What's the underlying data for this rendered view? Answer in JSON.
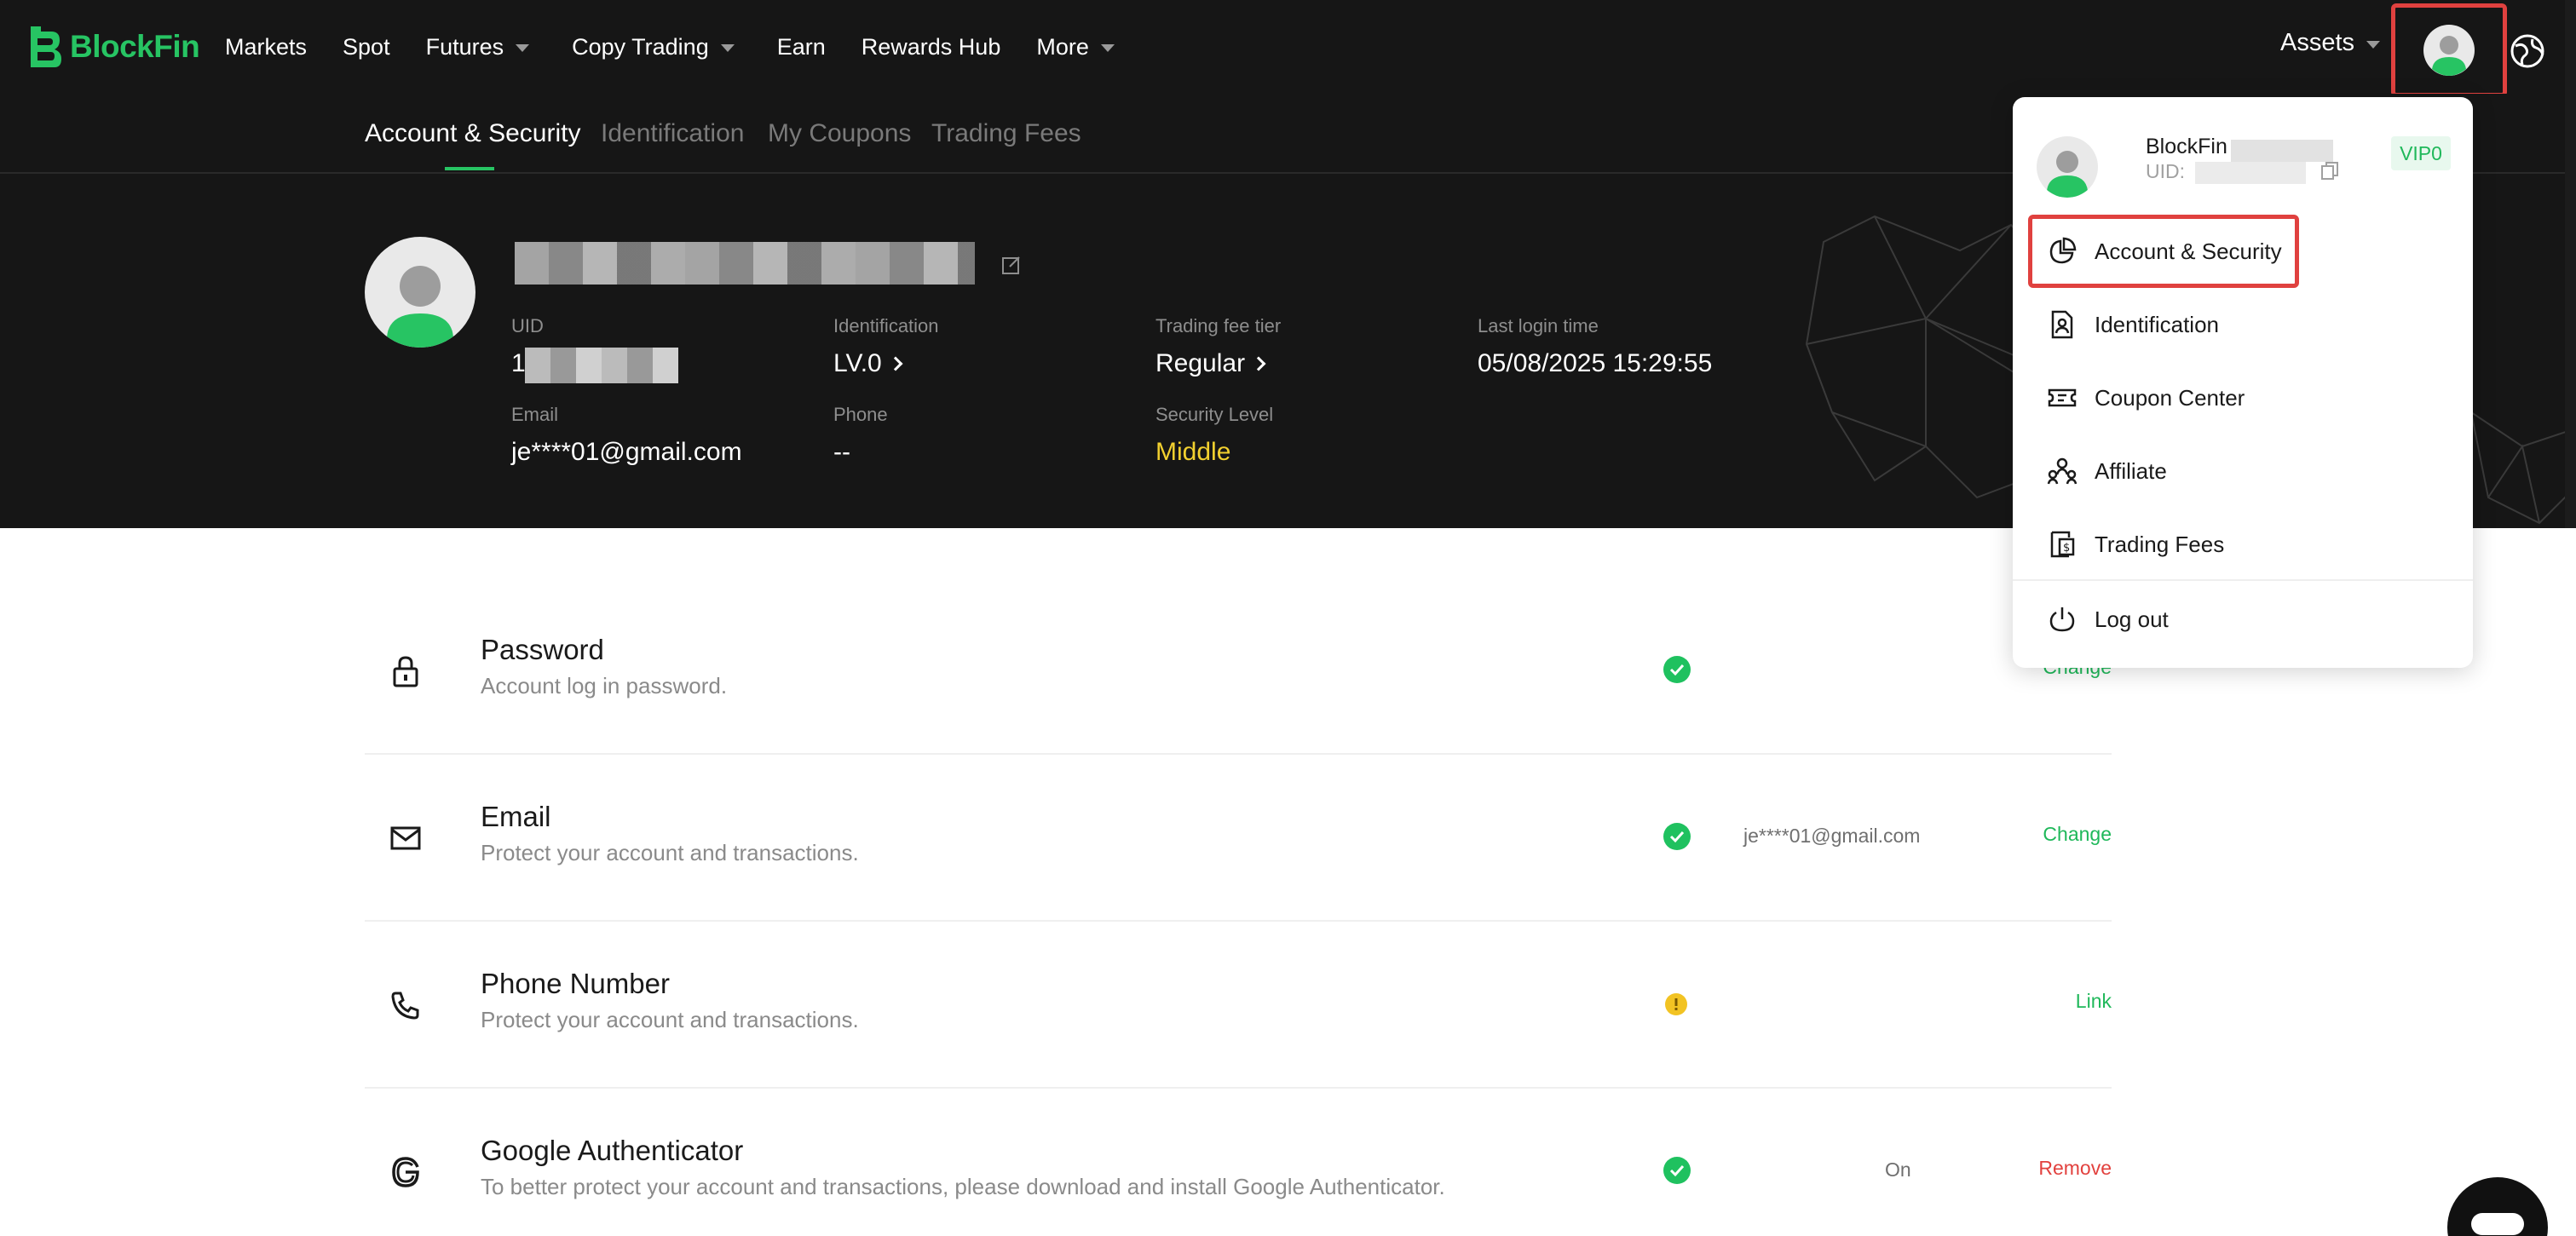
{
  "brand": {
    "name": "BlockFin",
    "accent": "#27c463"
  },
  "nav": {
    "items": [
      {
        "label": "Markets",
        "dropdown": false
      },
      {
        "label": "Spot",
        "dropdown": false
      },
      {
        "label": "Futures",
        "dropdown": true
      },
      {
        "label": "Copy Trading",
        "dropdown": true
      },
      {
        "label": "Earn",
        "dropdown": false
      },
      {
        "label": "Rewards Hub",
        "dropdown": false
      },
      {
        "label": "More",
        "dropdown": true
      }
    ],
    "assets_label": "Assets"
  },
  "tabs": [
    {
      "label": "Account & Security",
      "active": true
    },
    {
      "label": "Identification",
      "active": false
    },
    {
      "label": "My Coupons",
      "active": false
    },
    {
      "label": "Trading Fees",
      "active": false
    }
  ],
  "profile": {
    "uid_label": "UID",
    "uid_value": "1",
    "identification_label": "Identification",
    "identification_value": "LV.0",
    "fee_tier_label": "Trading fee tier",
    "fee_tier_value": "Regular",
    "last_login_label": "Last login time",
    "last_login_value": "05/08/2025 15:29:55",
    "email_label": "Email",
    "email_value": "je****01@gmail.com",
    "phone_label": "Phone",
    "phone_value": "--",
    "security_label": "Security Level",
    "security_value": "Middle"
  },
  "security_rows": [
    {
      "title": "Password",
      "desc": "Account log in password.",
      "status": "ok",
      "value": "",
      "action": "Change",
      "action_color": "green",
      "icon": "lock-icon"
    },
    {
      "title": "Email",
      "desc": "Protect your account and transactions.",
      "status": "ok",
      "value": "je****01@gmail.com",
      "action": "Change",
      "action_color": "green",
      "icon": "mail-icon"
    },
    {
      "title": "Phone Number",
      "desc": "Protect your account and transactions.",
      "status": "warn",
      "value": "",
      "action": "Link",
      "action_color": "green",
      "icon": "phone-icon"
    },
    {
      "title": "Google Authenticator",
      "desc": "To better protect your account and transactions, please download and install Google Authenticator.",
      "status": "ok",
      "value": "On",
      "action": "Remove",
      "action_color": "red",
      "icon": "google-icon"
    }
  ],
  "dropdown": {
    "name": "BlockFin",
    "uid_label": "UID:",
    "vip": "VIP0",
    "items": [
      {
        "label": "Account & Security",
        "icon": "pie-chart-icon"
      },
      {
        "label": "Identification",
        "icon": "id-card-icon"
      },
      {
        "label": "Coupon Center",
        "icon": "ticket-icon"
      },
      {
        "label": "Affiliate",
        "icon": "team-icon"
      },
      {
        "label": "Trading Fees",
        "icon": "fee-doc-icon"
      },
      {
        "label": "Log out",
        "icon": "power-icon"
      }
    ]
  }
}
